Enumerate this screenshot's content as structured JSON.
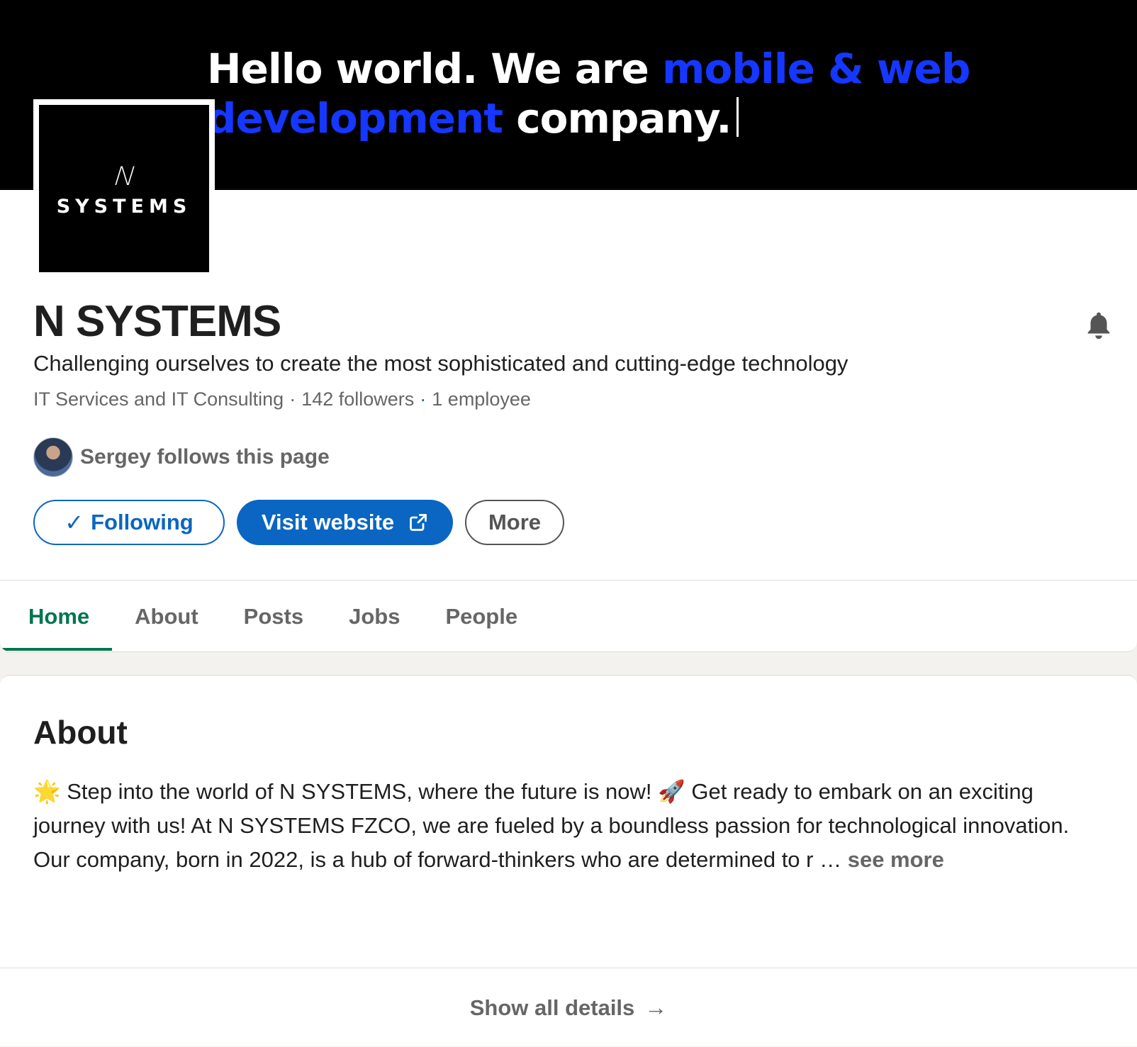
{
  "banner": {
    "line1_white": "Hello world. We are ",
    "line1_accent": "mobile & web",
    "line2_accent": "development",
    "line2_white": " company.",
    "accent_color": "#1537ff"
  },
  "logo": {
    "mark": "/\\/",
    "wordmark": "SYSTEMS"
  },
  "company": {
    "name": "N SYSTEMS",
    "tagline": "Challenging ourselves to create the most sophisticated and cutting-edge technology",
    "industry": "IT Services and IT Consulting",
    "followers": "142 followers",
    "employees": "1 employee"
  },
  "follower_note": "Sergey follows this page",
  "actions": {
    "following_label": "Following",
    "visit_label": "Visit website",
    "more_label": "More"
  },
  "tabs": [
    {
      "label": "Home",
      "active": true
    },
    {
      "label": "About",
      "active": false
    },
    {
      "label": "Posts",
      "active": false
    },
    {
      "label": "Jobs",
      "active": false
    },
    {
      "label": "People",
      "active": false
    }
  ],
  "about": {
    "title": "About",
    "text": "🌟 Step into the world of N SYSTEMS, where the future is now! 🚀 Get ready to embark on an exciting journey with us! At N SYSTEMS FZCO, we are fueled by a boundless passion for technological innovation. Our company, born in 2022, is a hub of forward-thinkers who are determined to r … ",
    "see_more": "see more",
    "show_all": "Show all details"
  },
  "colors": {
    "brand_blue": "#0a66c2",
    "active_tab": "#01754f",
    "muted_text": "#666666"
  }
}
